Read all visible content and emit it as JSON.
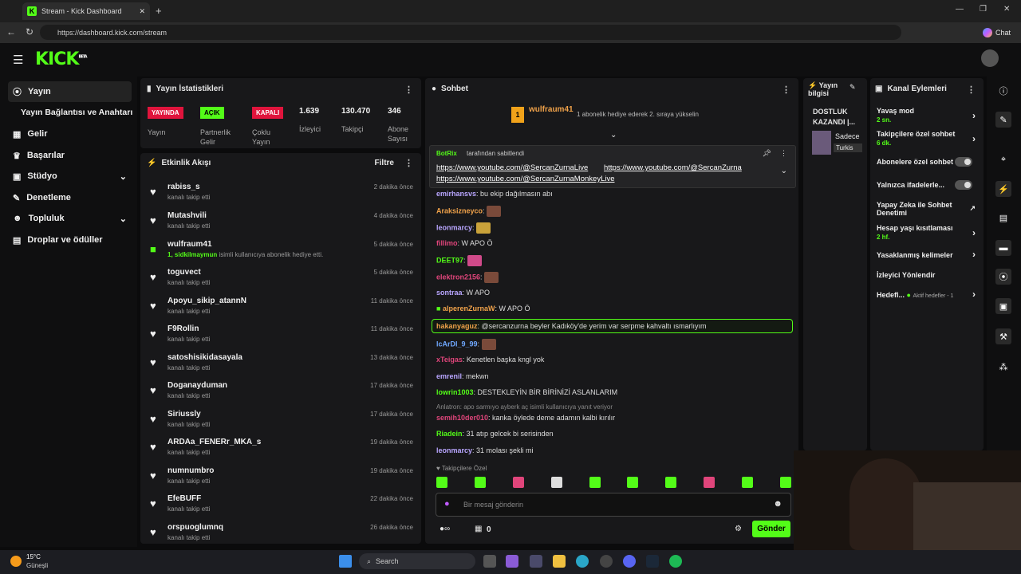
{
  "browser": {
    "tab_title": "Stream - Kick Dashboard",
    "url": "https://dashboard.kick.com/stream",
    "chat_label": "Chat"
  },
  "brand": {
    "logo": "KICK",
    "beta": "BETA",
    "accent": "#53fc18"
  },
  "sidebar": {
    "items": [
      {
        "label": "Yayın",
        "icon": "broadcast-icon"
      },
      {
        "label": "Yayın Bağlantısı ve Anahtarı",
        "icon": ""
      },
      {
        "label": "Gelir",
        "icon": "income-icon"
      },
      {
        "label": "Başarılar",
        "icon": "trophy-icon"
      },
      {
        "label": "Stüdyo",
        "icon": "studio-icon"
      },
      {
        "label": "Denetleme",
        "icon": "wrench-icon"
      },
      {
        "label": "Topluluk",
        "icon": "community-icon"
      },
      {
        "label": "Droplar ve ödüller",
        "icon": "gift-icon"
      }
    ]
  },
  "stats": {
    "title": "Yayın İstatistikleri",
    "items": [
      {
        "badge": "YAYINDA",
        "label": "Yayın"
      },
      {
        "badge": "AÇIK",
        "label": "Partnerlik Gelir"
      },
      {
        "badge": "KAPALI",
        "label": "Çoklu Yayın"
      },
      {
        "value": "1.639",
        "label": "İzleyici"
      },
      {
        "value": "130.470",
        "label": "Takipçi"
      },
      {
        "value": "346",
        "label": "Abone Sayısı"
      }
    ]
  },
  "feed": {
    "title": "Etkinlik Akışı",
    "filter": "Filtre",
    "rows": [
      {
        "name": "rabiss_s",
        "sub": "kanalı takip etti",
        "time": "2 dakika önce"
      },
      {
        "name": "Mutashvili",
        "sub": "kanalı takip etti",
        "time": "4 dakika önce"
      },
      {
        "name": "wulfraum41",
        "sub_a": "1, sidkilmaymun",
        "sub_b": " isimli kullanıcıya abonelik hediye etti.",
        "time": "5 dakika önce"
      },
      {
        "name": "toguvect",
        "sub": "kanalı takip etti",
        "time": "5 dakika önce"
      },
      {
        "name": "Apoyu_sikip_atannN",
        "sub": "kanalı takip etti",
        "time": "11 dakika önce"
      },
      {
        "name": "F9Rollin",
        "sub": "kanalı takip etti",
        "time": "11 dakika önce"
      },
      {
        "name": "satoshisikidasayala",
        "sub": "kanalı takip etti",
        "time": "13 dakika önce"
      },
      {
        "name": "Doganayduman",
        "sub": "kanalı takip etti",
        "time": "17 dakika önce"
      },
      {
        "name": "Siriussly",
        "sub": "kanalı takip etti",
        "time": "17 dakika önce"
      },
      {
        "name": "ARDAa_FENERr_MKA_s",
        "sub": "kanalı takip etti",
        "time": "19 dakika önce"
      },
      {
        "name": "numnumbro",
        "sub": "kanalı takip etti",
        "time": "19 dakika önce"
      },
      {
        "name": "EfeBUFF",
        "sub": "kanalı takip etti",
        "time": "22 dakika önce"
      },
      {
        "name": "orspuoglumnq",
        "sub": "kanalı takip etti",
        "time": "26 dakika önce"
      }
    ]
  },
  "chat": {
    "title": "Sohbet",
    "gifter": "wulfraum41",
    "gift_count": "1",
    "gift_text": "1 abonelik hediye ederek 2. sıraya yükselin",
    "pinned": {
      "user": "BotRix",
      "suffix": "tarafından sabitlendi",
      "link1": "https://www.youtube.com/@SercanZurnaLive",
      "link2": "https://www.youtube.com/@SercanZurna",
      "link3": "https://www.youtube.com/@SercanZurnaMonkeyLive"
    },
    "messages": [
      {
        "user": "emirhansvs",
        "color": "#b9a6ff",
        "text": ": bu ekip dağılmasın abı"
      },
      {
        "user": "Araksizneyco",
        "color": "#f0a24a",
        "text": ":",
        "emote": true
      },
      {
        "user": "leonmarcy",
        "color": "#b9a6ff",
        "text": ":",
        "emote": true
      },
      {
        "user": "fillimo",
        "color": "#e0457b",
        "text": ": W APO Ö"
      },
      {
        "user": "DEET97",
        "color": "#53fc18",
        "text": ":",
        "emote": true
      },
      {
        "user": "elektron2156",
        "color": "#e0457b",
        "text": ":",
        "emote": true
      },
      {
        "user": "sontraa",
        "color": "#b9a6ff",
        "text": ": W APO"
      },
      {
        "user": "alperenZurnaW",
        "color": "#f0a24a",
        "text": ": W APO Ö"
      },
      {
        "user": "hakanyaguz",
        "color": "#f0a24a",
        "text": ": @sercanzurna beyler Kadıköy'de yerim var serpme kahvaltı ısmarlıyım",
        "highlight": true
      },
      {
        "user": "lcArDl_9_99",
        "color": "#6fa8ff",
        "text": ":",
        "emote": true
      },
      {
        "user": "xTeigas",
        "color": "#e0457b",
        "text": ": Kenetlen başka kngl yok"
      },
      {
        "user": "emrenil",
        "color": "#b9a6ff",
        "text": ": mekwn"
      },
      {
        "user": "lowrin1003",
        "color": "#53fc18",
        "text": ": DESTEKLEYİN BİR BİRİNİZİ ASLANLARIM"
      },
      {
        "user": "semih10der010",
        "color": "#e0457b",
        "text": ": kanka öylede deme adamın kalbi kırılır",
        "reply": "Anlatron: apo sarmıyo ayberk aç isimli kullanıcıya yanıt veriyor"
      },
      {
        "user": "Riadein",
        "color": "#53fc18",
        "text": ": 31 atıp gelcek bi serisinden"
      },
      {
        "user": "leonmarcy",
        "color": "#b9a6ff",
        "text": ": 31 molası şekli mi"
      }
    ],
    "followers_only": "Takipçilere Özel",
    "input_placeholder": "Bir mesaj gönderin",
    "points": "0",
    "send": "Gönder"
  },
  "info": {
    "title": "Yayın bilgisi",
    "headline": "DOSTLUK KAZANDI |...",
    "category_a": "Sadece",
    "category_b": "Turkis"
  },
  "actions": {
    "title": "Kanal Eylemleri",
    "items": [
      {
        "label": "Yavaş mod",
        "value": "2 sn.",
        "kind": "chev"
      },
      {
        "label": "Takipçilere özel sohbet",
        "value": "6 dk.",
        "kind": "chev"
      },
      {
        "label": "Abonelere özel sohbet",
        "value": "",
        "kind": "toggle"
      },
      {
        "label": "Yalnızca ifadelerle...",
        "value": "",
        "kind": "toggle"
      },
      {
        "label": "Yapay Zeka ile Sohbet Denetimi",
        "value": "",
        "kind": "ext"
      },
      {
        "label": "Hesap yaşı kısıtlaması",
        "value": "2 hf.",
        "kind": "chev"
      },
      {
        "label": "Yasaklanmış kelimeler",
        "value": "",
        "kind": "chev"
      },
      {
        "label": "İzleyici Yönlendir",
        "value": "",
        "kind": ""
      },
      {
        "label": "Hedefl...",
        "value": "Aktif hedefler - 1",
        "kind": "chev"
      }
    ]
  },
  "taskbar": {
    "temp": "15°C",
    "weather": "Güneşli",
    "search": "Search"
  }
}
